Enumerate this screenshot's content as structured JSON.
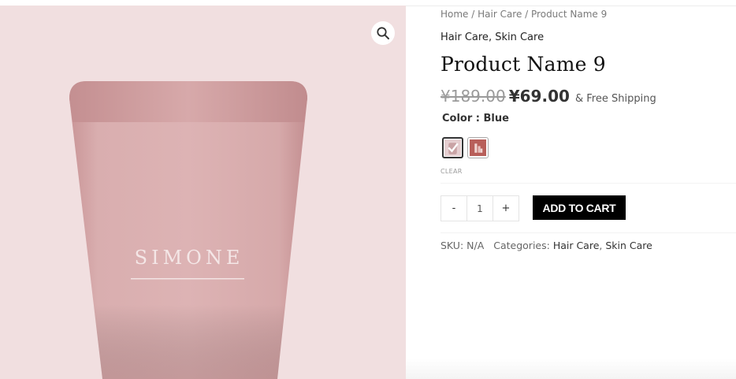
{
  "breadcrumb": {
    "home": "Home",
    "sep1": " / ",
    "category": "Hair Care",
    "sep2": " / ",
    "current": "Product Name 9"
  },
  "categories_top": {
    "first": "Hair Care",
    "sep": ", ",
    "second": "Skin Care"
  },
  "product": {
    "title": "Product Name 9",
    "old_price": "¥189.00",
    "new_price": "¥69.00",
    "shipping": "& Free Shipping",
    "brand_print": "SIMONE"
  },
  "variation": {
    "label": "Color : Blue",
    "swatches": [
      {
        "name": "blue",
        "selected": true,
        "color": "#e6cfd1"
      },
      {
        "name": "second",
        "selected": false,
        "color": "#b85f5a"
      }
    ],
    "clear_label": "CLEAR"
  },
  "cart": {
    "minus": "-",
    "qty": "1",
    "plus": "+",
    "add_label": "ADD TO CART"
  },
  "meta": {
    "sku_label": "SKU: N/A",
    "categories_label": "Categories: ",
    "cat1": "Hair Care",
    "sep": ", ",
    "cat2": "Skin Care"
  },
  "colors": {
    "gallery_bg": "#f1dfe0",
    "tube": "#d6a8a9",
    "button_bg": "#000000"
  },
  "icons": {
    "zoom": "search-icon",
    "swatch_check": "check-icon"
  }
}
